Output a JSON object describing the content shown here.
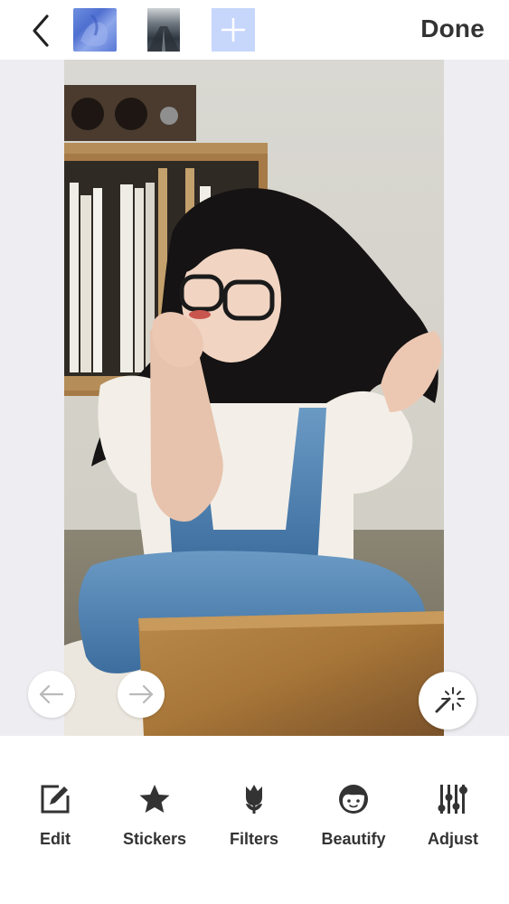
{
  "header": {
    "back_icon": "chevron-left-icon",
    "thumbnails": [
      {
        "name": "photo-thumbnail-1",
        "accent": "#5b7bd8"
      },
      {
        "name": "photo-thumbnail-2",
        "accent": "#4a5560"
      }
    ],
    "add_icon": "plus-icon",
    "add_color": "#c7d6fb",
    "done_label": "Done"
  },
  "canvas": {
    "background": "#eeedf1",
    "prev_icon": "arrow-left-icon",
    "next_icon": "arrow-right-icon",
    "magic_icon": "magic-wand-icon"
  },
  "toolbar": {
    "items": [
      {
        "label": "Edit",
        "icon": "edit-icon"
      },
      {
        "label": "Stickers",
        "icon": "star-icon"
      },
      {
        "label": "Filters",
        "icon": "tulip-icon"
      },
      {
        "label": "Beautify",
        "icon": "face-icon"
      },
      {
        "label": "Adjust",
        "icon": "sliders-icon"
      }
    ]
  }
}
